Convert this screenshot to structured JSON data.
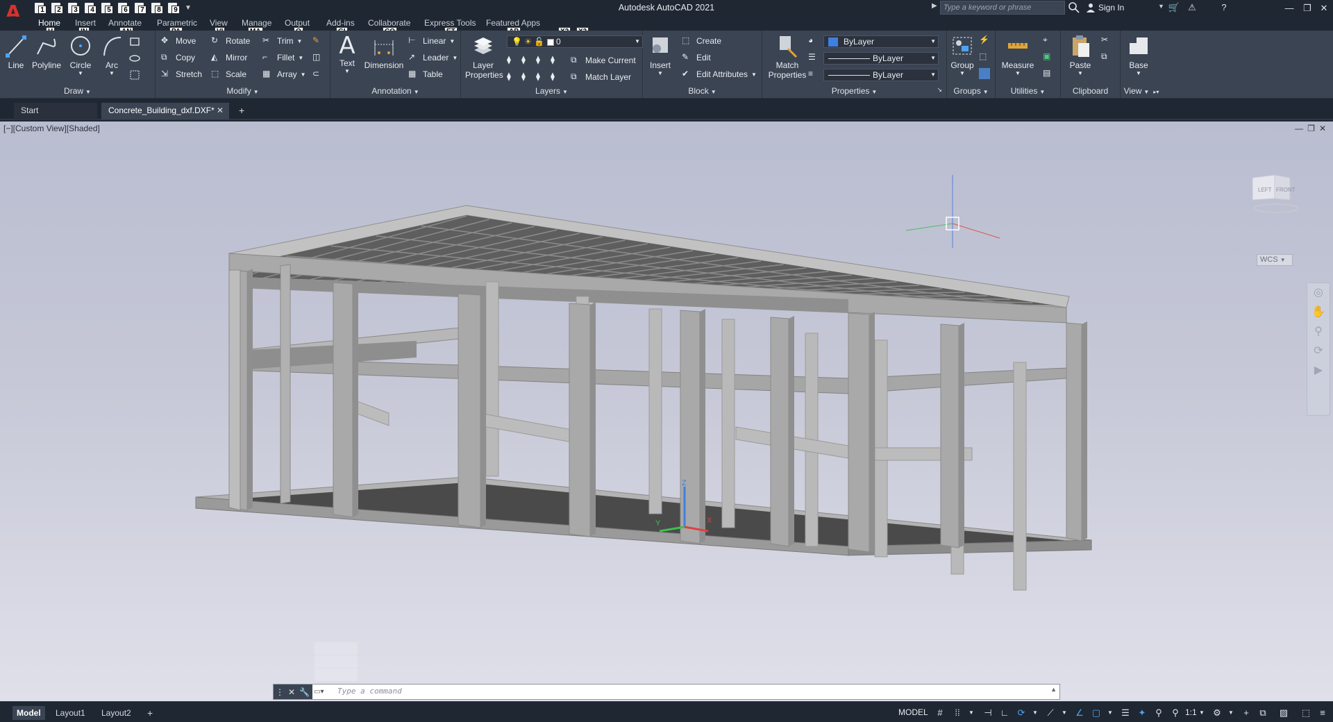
{
  "window": {
    "title": "Autodesk AutoCAD 2021",
    "app_logo": "A",
    "search_placeholder": "Type a keyword or phrase",
    "sign_in": "Sign In"
  },
  "quick_access": {
    "keytips": [
      "1",
      "2",
      "3",
      "4",
      "5",
      "6",
      "7",
      "8",
      "9"
    ]
  },
  "ribbon_tabs": [
    {
      "label": "Home",
      "keytip": "H",
      "active": true
    },
    {
      "label": "Insert",
      "keytip": "IN"
    },
    {
      "label": "Annotate",
      "keytip": "AN"
    },
    {
      "label": "Parametric",
      "keytip": "PA"
    },
    {
      "label": "View",
      "keytip": "VI"
    },
    {
      "label": "Manage",
      "keytip": "MA"
    },
    {
      "label": "Output",
      "keytip": "O"
    },
    {
      "label": "Add-ins",
      "keytip": ""
    },
    {
      "label": "Collaborate",
      "keytip": "CO"
    },
    {
      "label": "Express Tools",
      "keytip": "ET"
    },
    {
      "label": "Featured Apps",
      "keytip": "AP"
    }
  ],
  "extra_keytips": {
    "gi": "GI",
    "x2": "X2",
    "x3": "X3"
  },
  "panels": {
    "draw": {
      "title": "Draw",
      "tools": {
        "line": "Line",
        "polyline": "Polyline",
        "circle": "Circle",
        "arc": "Arc"
      }
    },
    "modify": {
      "title": "Modify",
      "tools": {
        "move": "Move",
        "rotate": "Rotate",
        "trim": "Trim",
        "copy": "Copy",
        "mirror": "Mirror",
        "fillet": "Fillet",
        "stretch": "Stretch",
        "scale": "Scale",
        "array": "Array"
      }
    },
    "annotation": {
      "title": "Annotation",
      "tools": {
        "text": "Text",
        "dimension": "Dimension",
        "linear": "Linear",
        "leader": "Leader",
        "table": "Table"
      }
    },
    "layers": {
      "title": "Layers",
      "layer_properties_line1": "Layer",
      "layer_properties_line2": "Properties",
      "current_layer": "0",
      "make_current": "Make Current",
      "match_layer": "Match Layer"
    },
    "block": {
      "title": "Block",
      "insert": "Insert",
      "create": "Create",
      "edit": "Edit",
      "edit_attributes": "Edit Attributes"
    },
    "properties": {
      "title": "Properties",
      "match_line1": "Match",
      "match_line2": "Properties",
      "color": "ByLayer",
      "linetype": "ByLayer",
      "lineweight": "ByLayer",
      "color_swatch": "#3f7fe0"
    },
    "groups": {
      "title": "Groups",
      "group": "Group"
    },
    "utilities": {
      "title": "Utilities",
      "measure": "Measure"
    },
    "clipboard": {
      "title": "Clipboard",
      "paste": "Paste"
    },
    "view": {
      "title": "View",
      "base": "Base"
    }
  },
  "doc_tabs": {
    "start": "Start",
    "active": "Concrete_Building_dxf.DXF*"
  },
  "viewport": {
    "label": "[−][Custom View][Shaded]",
    "viewcube_left": "LEFT",
    "viewcube_front": "FRONT",
    "wcs": "WCS",
    "ucs_z": "Z",
    "ucs_x": "X",
    "ucs_y": "Y"
  },
  "command_line": {
    "placeholder": "Type a command"
  },
  "status": {
    "layout_tabs": [
      "Model",
      "Layout1",
      "Layout2"
    ],
    "model_space": "MODEL",
    "scale": "1:1"
  },
  "colors": {
    "app_dark": "#1f2733",
    "ribbon": "#3b4453",
    "brand_red": "#d8322c",
    "structure": "#a9a9a9"
  }
}
